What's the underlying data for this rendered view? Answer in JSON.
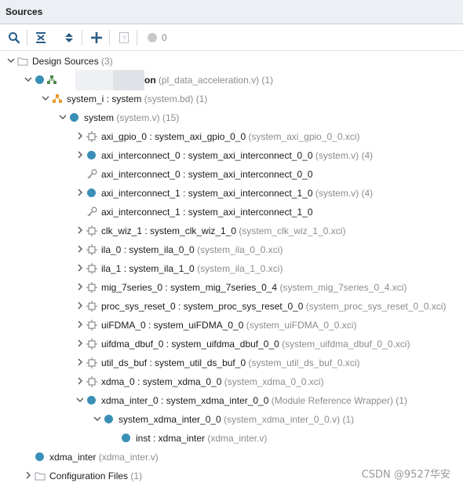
{
  "panel": {
    "title": "Sources"
  },
  "toolbar": {
    "search_icon": "search-icon",
    "collapse_all_icon": "collapse-all-icon",
    "expand_all_icon": "expand-all-icon",
    "add_icon": "add-icon",
    "help_icon": "help-icon",
    "status_icon": "status-circle-icon",
    "status_count": "0"
  },
  "tree": {
    "design_sources": {
      "label": "Design Sources",
      "count": " (3)"
    },
    "top_module": {
      "label": "on",
      "file": " (pl_data_acceleration.v) (1)"
    },
    "system_i": {
      "label": "system_i : system",
      "file": " (system.bd) (1)"
    },
    "system": {
      "label": "system",
      "file": " (system.v) (15)"
    },
    "items": [
      {
        "label": "axi_gpio_0 : system_axi_gpio_0_0",
        "file": " (system_axi_gpio_0_0.xci)"
      },
      {
        "label": "axi_interconnect_0 : system_axi_interconnect_0_0",
        "file": " (system.v) (4)"
      },
      {
        "label": "axi_interconnect_0 : system_axi_interconnect_0_0",
        "file": ""
      },
      {
        "label": "axi_interconnect_1 : system_axi_interconnect_1_0",
        "file": " (system.v) (4)"
      },
      {
        "label": "axi_interconnect_1 : system_axi_interconnect_1_0",
        "file": ""
      },
      {
        "label": "clk_wiz_1 : system_clk_wiz_1_0",
        "file": " (system_clk_wiz_1_0.xci)"
      },
      {
        "label": "ila_0 : system_ila_0_0",
        "file": " (system_ila_0_0.xci)"
      },
      {
        "label": "ila_1 : system_ila_1_0",
        "file": " (system_ila_1_0.xci)"
      },
      {
        "label": "mig_7series_0 : system_mig_7series_0_4",
        "file": " (system_mig_7series_0_4.xci)"
      },
      {
        "label": "proc_sys_reset_0 : system_proc_sys_reset_0_0",
        "file": " (system_proc_sys_reset_0_0.xci)"
      },
      {
        "label": "uiFDMA_0 : system_uiFDMA_0_0",
        "file": " (system_uiFDMA_0_0.xci)"
      },
      {
        "label": "uifdma_dbuf_0 : system_uifdma_dbuf_0_0",
        "file": " (system_uifdma_dbuf_0_0.xci)"
      },
      {
        "label": "util_ds_buf : system_util_ds_buf_0",
        "file": " (system_util_ds_buf_0.xci)"
      },
      {
        "label": "xdma_0 : system_xdma_0_0",
        "file": " (system_xdma_0_0.xci)"
      },
      {
        "label": "xdma_inter_0 : system_xdma_inter_0_0",
        "file": " (Module Reference Wrapper) (1)"
      },
      {
        "label": "system_xdma_inter_0_0",
        "file": " (system_xdma_inter_0_0.v) (1)"
      },
      {
        "label": "inst : xdma_inter",
        "file": " (xdma_inter.v)"
      }
    ],
    "xdma_inter": {
      "label": "xdma_inter",
      "file": " (xdma_inter.v)"
    },
    "config_files": {
      "label": "Configuration Files",
      "count": " (1)"
    }
  },
  "watermark": "CSDN @9527华安",
  "colors": {
    "accent": "#3a8fb7",
    "header_bg": "#eceff3",
    "muted_text": "#8c8c8c"
  }
}
